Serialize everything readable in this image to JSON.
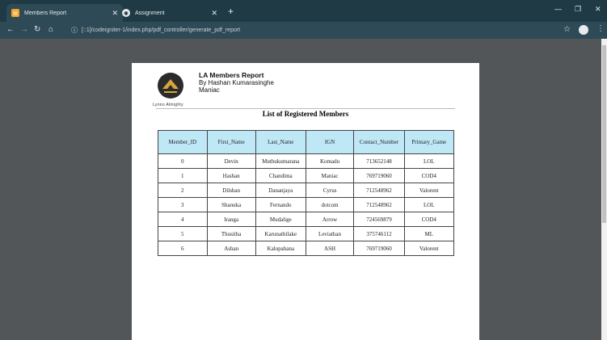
{
  "browser": {
    "tabs": [
      {
        "title": "Members Report",
        "active": true,
        "favicon": "report-icon"
      },
      {
        "title": "Assignment",
        "active": false,
        "favicon": "globe-icon"
      }
    ],
    "address": "[::1]/codeigniter-1/index.php/pdf_controller/generate_pdf_report"
  },
  "report": {
    "title": "LA Members Report",
    "by": "By Hashan Kumarasinghe",
    "subtitle": "Maniac",
    "brand": "Lynno Almighty",
    "list_title": "List of Registered Members",
    "columns": [
      "Member_ID",
      "First_Name",
      "Last_Name",
      "IGN",
      "Contact_Number",
      "Primary_Game"
    ],
    "rows": [
      [
        "0",
        "Devin",
        "Muthukumarana",
        "Komadu",
        "713652148",
        "LOL"
      ],
      [
        "1",
        "Hashan",
        "Chandima",
        "Maniac",
        "769719060",
        "COD4"
      ],
      [
        "2",
        "Dilshan",
        "Dananjaya",
        "Cyrus",
        "712548962",
        "Valorent"
      ],
      [
        "3",
        "Shanuka",
        "Fernando",
        "dotcom",
        "712548962",
        "LOL"
      ],
      [
        "4",
        "Iranga",
        "Mudalige",
        "Arrow",
        "724569879",
        "COD4"
      ],
      [
        "5",
        "Thusitha",
        "Karunathilake",
        "Leviathan",
        "375746112",
        "ML"
      ],
      [
        "6",
        "Ashan",
        "Kalupahana",
        "ASH",
        "769719060",
        "Valorent"
      ]
    ]
  }
}
